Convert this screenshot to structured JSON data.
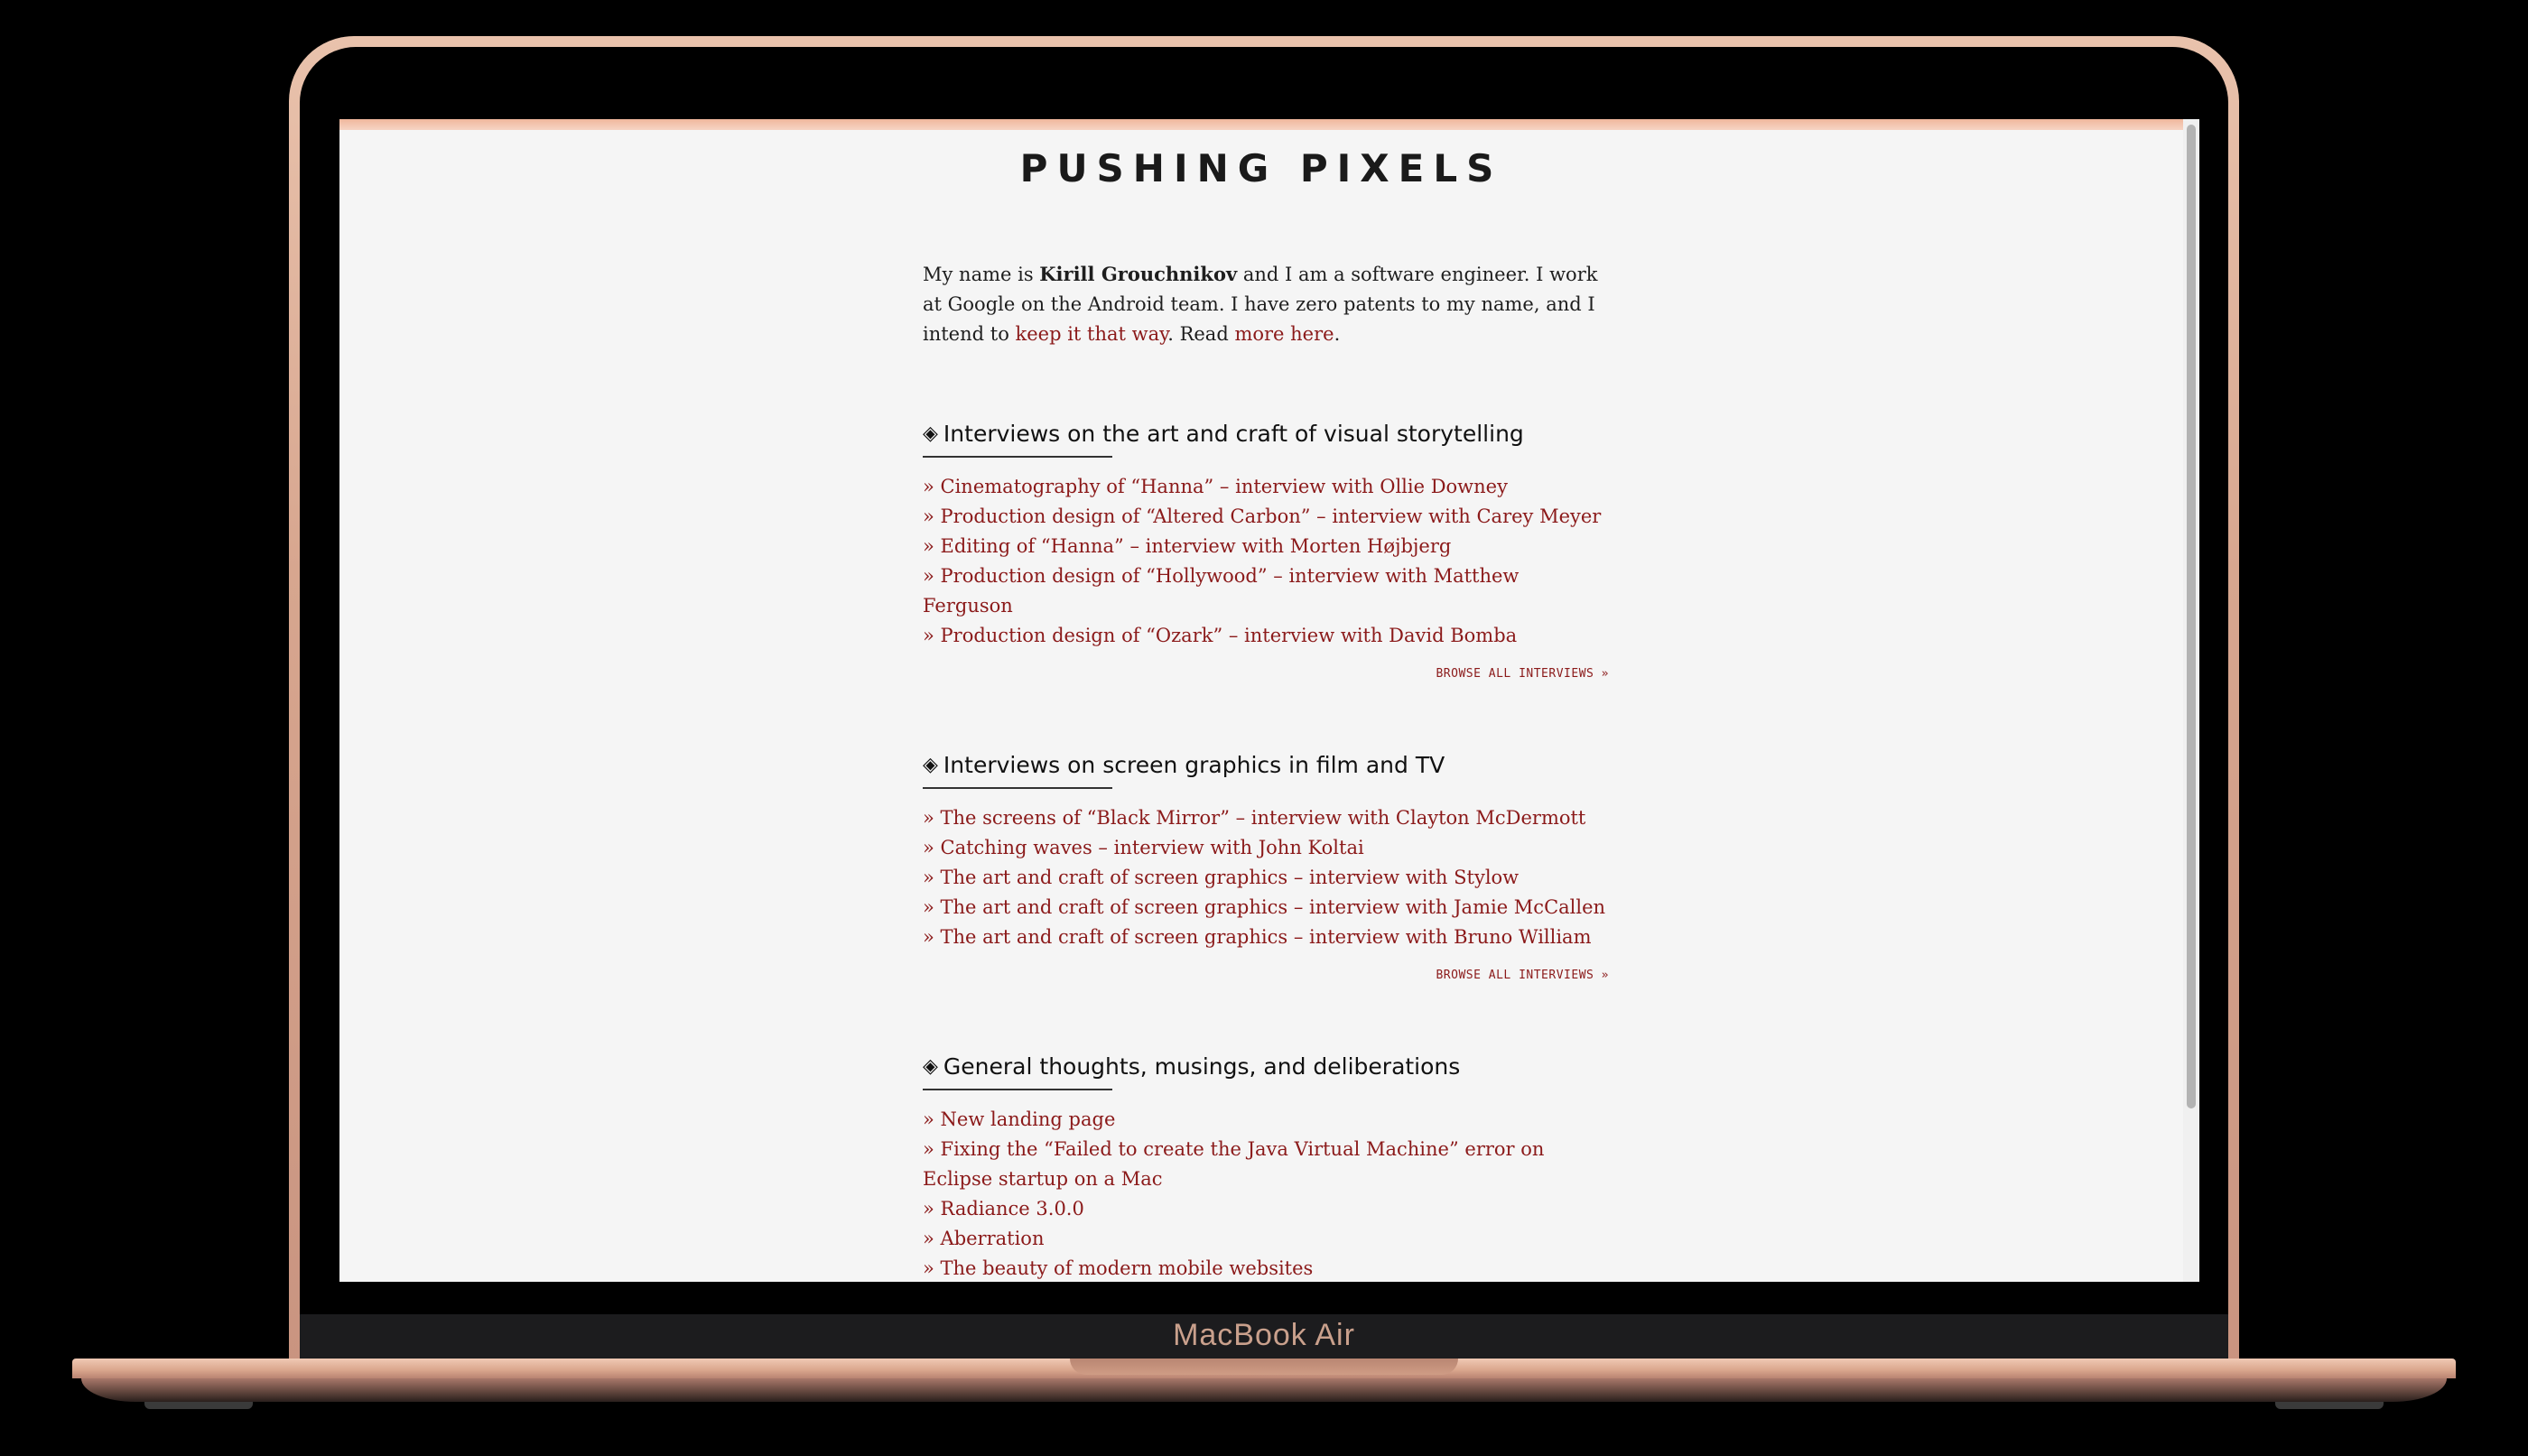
{
  "device": {
    "label": "MacBook Air"
  },
  "site": {
    "title": "PUSHING PIXELS"
  },
  "intro": {
    "prefix": "My name is ",
    "name": "Kirill Grouchnikov",
    "middle": " and I am a software engineer. I work at Google on the Android team. I have zero patents to my name, and I intend to ",
    "link1": "keep it that way",
    "middle2": ". Read ",
    "link2": "more here",
    "suffix": "."
  },
  "sections": [
    {
      "icon": "diamond-icon",
      "heading": "Interviews on the art and craft of visual storytelling",
      "items": [
        "» Cinematography of “Hanna” – interview with Ollie Downey",
        "» Production design of “Altered Carbon” – interview with Carey Meyer",
        "» Editing of “Hanna” – interview with Morten Højbjerg",
        "» Production design of “Hollywood” – interview with Matthew Ferguson",
        "» Production design of “Ozark” – interview with David Bomba"
      ],
      "browse": "BROWSE ALL INTERVIEWS »"
    },
    {
      "icon": "diamond-icon",
      "heading": "Interviews on screen graphics in film and TV",
      "items": [
        "» The screens of “Black Mirror” – interview with Clayton McDermott",
        "» Catching waves – interview with John Koltai",
        "» The art and craft of screen graphics – interview with Stylow",
        "» The art and craft of screen graphics – interview with Jamie McCallen",
        "» The art and craft of screen graphics – interview with Bruno William"
      ],
      "browse": "BROWSE ALL INTERVIEWS »"
    },
    {
      "icon": "diamond-icon",
      "heading": "General thoughts, musings, and deliberations",
      "items": [
        "» New landing page",
        "» Fixing the “Failed to create the Java Virtual Machine” error on Eclipse startup on a Mac",
        "» Radiance 3.0.0",
        "» Aberration",
        "» The beauty of modern mobile websites"
      ]
    }
  ]
}
